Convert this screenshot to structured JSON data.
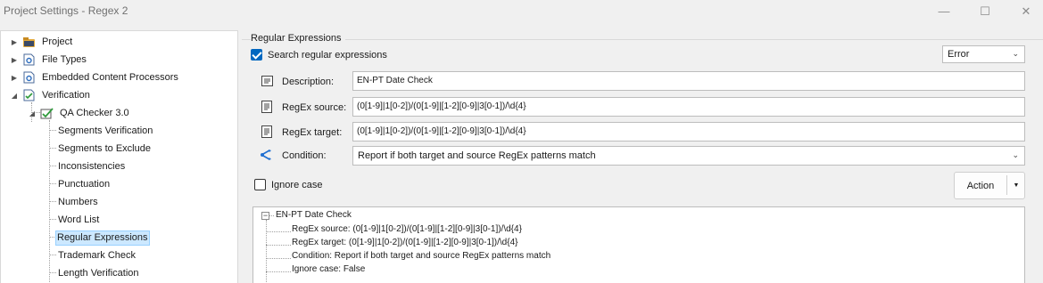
{
  "window": {
    "title": "Project Settings - Regex 2",
    "controls": {
      "minimize": "—",
      "maximize": "☐",
      "close": "✕"
    }
  },
  "tree": {
    "items": [
      {
        "label": "Project",
        "icon": "project-icon",
        "expander": "▶"
      },
      {
        "label": "File Types",
        "icon": "file-types-icon",
        "expander": "▶"
      },
      {
        "label": "Embedded Content Processors",
        "icon": "processor-icon",
        "expander": "▶"
      },
      {
        "label": "Verification",
        "icon": "verification-icon",
        "expander": "◢"
      },
      {
        "label": "QA Checker 3.0",
        "icon": "qa-checker-icon",
        "expander": "◢"
      },
      {
        "label": "Segments Verification"
      },
      {
        "label": "Segments to Exclude"
      },
      {
        "label": "Inconsistencies"
      },
      {
        "label": "Punctuation"
      },
      {
        "label": "Numbers"
      },
      {
        "label": "Word List"
      },
      {
        "label": "Regular Expressions",
        "selected": true
      },
      {
        "label": "Trademark Check"
      },
      {
        "label": "Length Verification"
      }
    ]
  },
  "panel": {
    "group_title": "Regular Expressions",
    "search_checkbox": {
      "label": "Search regular expressions",
      "checked": true
    },
    "severity": {
      "value": "Error"
    },
    "description": {
      "label": "Description:",
      "value": "EN-PT Date Check"
    },
    "regex_source": {
      "label": "RegEx source:",
      "value": "(0[1-9]|1[0-2])/(0[1-9]|[1-2][0-9]|3[0-1])/\\d{4}"
    },
    "regex_target": {
      "label": "RegEx target:",
      "value": "(0[1-9]|1[0-2])/(0[1-9]|[1-2][0-9]|3[0-1])/\\d{4}"
    },
    "condition": {
      "label": "Condition:",
      "value": "Report if both target and source RegEx patterns match"
    },
    "ignore_case": {
      "label": "Ignore case",
      "checked": false
    },
    "action_button": {
      "label": "Action",
      "arrow": "▼"
    }
  },
  "preview": {
    "title": "EN-PT Date Check",
    "toggle": "−",
    "lines": [
      "RegEx source: (0[1-9]|1[0-2])/(0[1-9]|[1-2][0-9]|3[0-1])/\\d{4}",
      "RegEx target: (0[1-9]|1[0-2])/(0[1-9]|[1-2][0-9]|3[0-1])/\\d{4}",
      "Condition: Report if both target and source RegEx patterns match",
      "Ignore case: False"
    ]
  },
  "colors": {
    "accent": "#0067c0",
    "selection": "#cce8ff",
    "selection_border": "#99d1ff",
    "window_bg": "#f0f0f0"
  }
}
